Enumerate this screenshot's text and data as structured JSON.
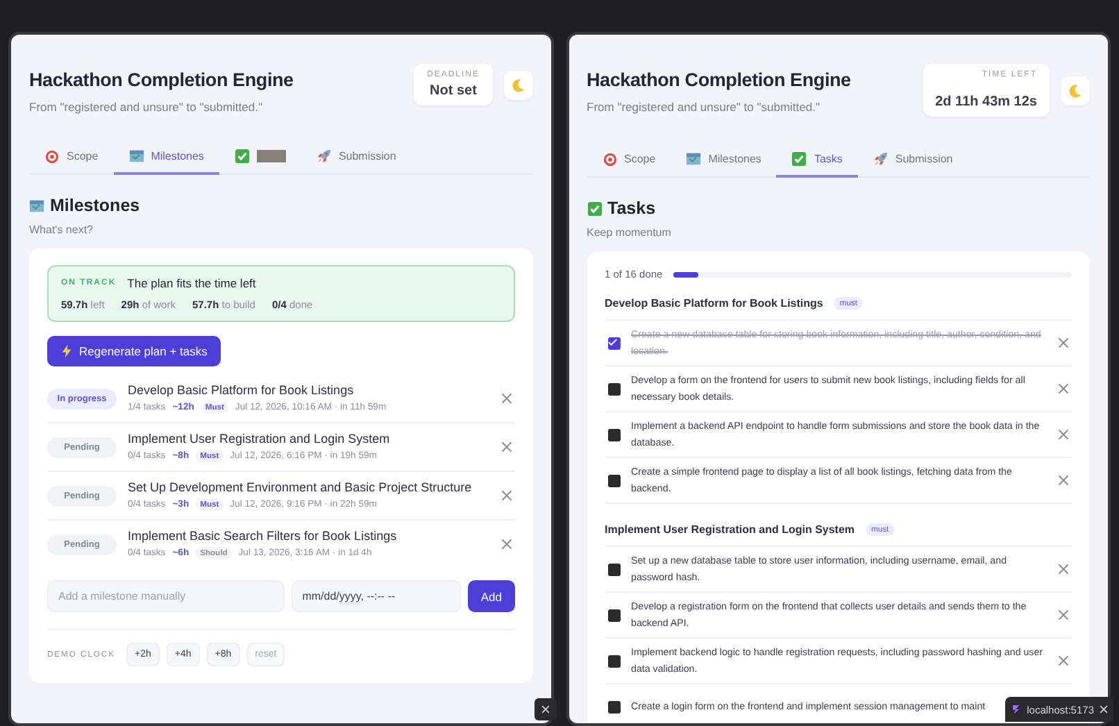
{
  "windows": [
    {
      "kind": "milestones",
      "title": "Hackathon Completion Engine",
      "subtitle": "From \"registered and unsure\" to \"submitted.\"",
      "timer": {
        "label": "DEADLINE",
        "value": "Not set"
      },
      "tabs": [
        {
          "label": "Scope",
          "selected": false
        },
        {
          "label": "Milestones",
          "selected": true
        },
        {
          "redacted": true,
          "selected": false
        },
        {
          "label": "Submission",
          "selected": false
        }
      ],
      "heading": {
        "text": "Milestones",
        "caption": "What's next?"
      },
      "status": {
        "badge": "ON TRACK",
        "message": "The plan fits the time left",
        "stats": [
          "**59.7h** left",
          "**29h** of work",
          "**57.7h** to build",
          "**0/4** done"
        ]
      },
      "regenerate_button": "Regenerate plan + tasks",
      "milestones": [
        {
          "kind": "active",
          "status": "In progress",
          "title": "Develop Basic Platform for Book Listings",
          "tasks": "1/4 tasks",
          "estimate": "~12h",
          "priority": {
            "text": "Must",
            "color": "#5b52d6"
          },
          "due": "Jul 12, 2026, 10:16 AM · in 11h 59m"
        },
        {
          "kind": "pending",
          "status": "Pending",
          "title": "Implement User Registration and Login System",
          "tasks": "0/4 tasks",
          "estimate": "~8h",
          "priority": {
            "text": "Must",
            "color": "#5b52d6"
          },
          "due": "Jul 12, 2026, 6:16 PM · in 19h 59m"
        },
        {
          "kind": "pending",
          "status": "Pending",
          "title": "Set Up Development Environment and Basic Project Structure",
          "tasks": "0/4 tasks",
          "estimate": "~3h",
          "priority": {
            "text": "Must",
            "color": "#5b52d6"
          },
          "due": "Jul 12, 2026, 9:16 PM · in 22h 59m"
        },
        {
          "kind": "pending",
          "status": "Pending",
          "title": "Implement Basic Search Filters for Book Listings",
          "tasks": "0/4 tasks",
          "estimate": "~6h",
          "priority": {
            "text": "Should",
            "color": "#8a8f9c"
          },
          "due": "Jul 13, 2026, 3:16 AM · in 1d 4h"
        }
      ],
      "add_form": {
        "placeholder": "Add a milestone manually",
        "date_placeholder": "mm/dd/yyyy, --:-- --",
        "button": "Add"
      },
      "demo_clock": {
        "label": "DEMO CLOCK",
        "buttons": [
          {
            "label": "+2h",
            "disabled": false
          },
          {
            "label": "+4h",
            "disabled": false
          },
          {
            "label": "+8h",
            "disabled": false
          },
          {
            "label": "reset",
            "disabled": true
          }
        ]
      }
    },
    {
      "kind": "tasks",
      "title": "Hackathon Completion Engine",
      "subtitle": "From \"registered and unsure\" to \"submitted.\"",
      "timer": {
        "label": "TIME LEFT",
        "value": "2d 11h 43m 12s"
      },
      "tabs": [
        {
          "label": "Scope",
          "selected": false
        },
        {
          "label": "Milestones",
          "selected": false
        },
        {
          "label": "Tasks",
          "selected": true
        },
        {
          "label": "Submission",
          "selected": false
        }
      ],
      "heading": {
        "text": "Tasks",
        "caption": "Keep momentum"
      },
      "progress": {
        "text": "1 of 16 done",
        "level": 0.0625
      },
      "groups": [
        {
          "title": "Develop Basic Platform for Book Listings",
          "priority": "must",
          "tasks": [
            {
              "text": "Create a new database table for storing book information, including title, author, condition, and location.",
              "checked": true
            },
            {
              "text": "Develop a form on the frontend for users to submit new book listings, including fields for all necessary book details.",
              "checked": false
            },
            {
              "text": "Implement a backend API endpoint to handle form submissions and store the book data in the database.",
              "checked": false
            },
            {
              "text": "Create a simple frontend page to display a list of all book listings, fetching data from the backend.",
              "checked": false
            }
          ]
        },
        {
          "title": "Implement User Registration and Login System",
          "priority": "must",
          "tasks": [
            {
              "text": "Set up a new database table to store user information, including username, email, and password hash.",
              "checked": false
            },
            {
              "text": "Develop a registration form on the frontend that collects user details and sends them to the backend API.",
              "checked": false
            },
            {
              "text": "Implement backend logic to handle registration requests, including password hashing and user data validation.",
              "checked": false
            },
            {
              "text": "Create a login form on the frontend and implement session management to maint",
              "checked": false,
              "covered": true
            }
          ]
        }
      ]
    }
  ],
  "toast": {
    "text": "localhost:5173"
  }
}
